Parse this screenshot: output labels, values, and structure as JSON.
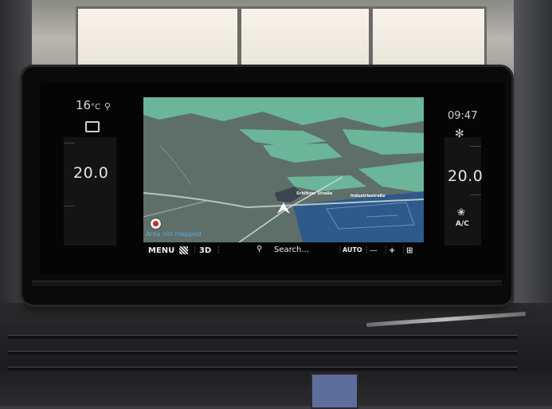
{
  "climate": {
    "outside_temp": "16",
    "outside_temp_unit": "°C",
    "left_setpoint": "20.0",
    "right_setpoint": "20.0",
    "clock": "09:47",
    "ac_label": "A/C"
  },
  "map": {
    "street_1": "Schlitzer Straße",
    "street_2": "Industriestraße",
    "status": "Area not mapped"
  },
  "navbar": {
    "menu_label": "MENU",
    "view_label": "3D",
    "search_label": "Search...",
    "zoom_mode": "AUTO",
    "zoom_out": "—",
    "zoom_in": "+"
  },
  "icons": [
    "location-pin-icon",
    "heated-seat-icon",
    "fan-icon",
    "recirculation-icon",
    "flag-icon",
    "search-icon",
    "compass-icon",
    "route-options-icon"
  ],
  "colors": {
    "map_land": "#5e6f6a",
    "map_green": "#6bb59a",
    "map_water_area": "#2d5a8a",
    "status_text": "#5fa8e0"
  }
}
